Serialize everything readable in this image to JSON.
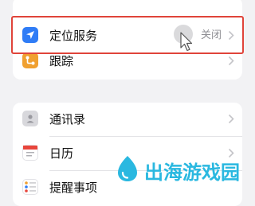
{
  "location_group": {
    "location_services": {
      "label": "定位服务",
      "value": "关闭"
    },
    "tracking": {
      "label": "跟踪"
    }
  },
  "apps_group": {
    "items": [
      {
        "label": "通讯录"
      },
      {
        "label": "日历"
      },
      {
        "label": "提醒事项"
      }
    ]
  },
  "watermark": {
    "text": "出海游戏园"
  },
  "colors": {
    "location_icon": "#2f7cf6",
    "tracking_icon": "#f0a030",
    "highlight_border": "#e0443a",
    "watermark": "#2ab8e0"
  },
  "icons": {
    "location_services": "location-arrow-icon",
    "tracking": "tracking-icon",
    "contacts": "contacts-icon",
    "calendar": "calendar-icon",
    "reminders": "reminders-icon"
  }
}
